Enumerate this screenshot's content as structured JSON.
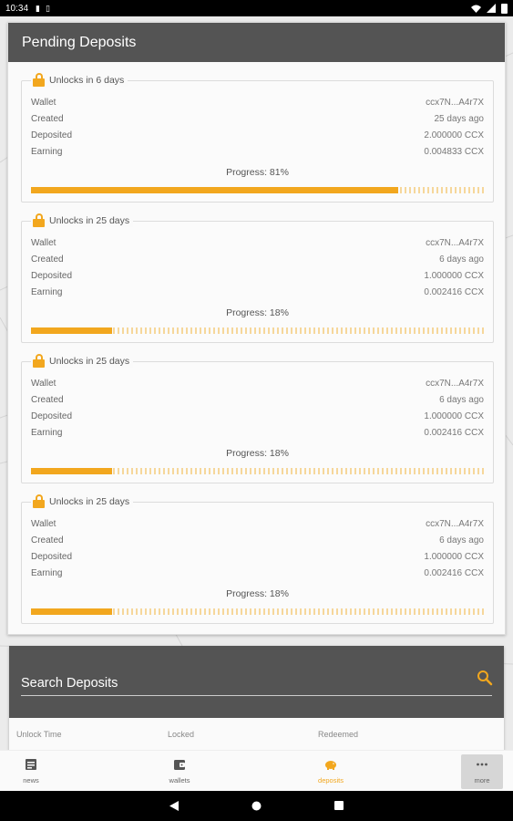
{
  "status_bar": {
    "time": "10:34"
  },
  "pending": {
    "title": "Pending Deposits",
    "deposits": [
      {
        "unlock": "Unlocks in 6 days",
        "wallet": "ccx7N...A4r7X",
        "created": "25 days ago",
        "deposited": "2.000000 CCX",
        "earning": "0.004833 CCX",
        "progress_text": "Progress:  81%",
        "progress": 0.81
      },
      {
        "unlock": "Unlocks in 25 days",
        "wallet": "ccx7N...A4r7X",
        "created": "6 days ago",
        "deposited": "1.000000 CCX",
        "earning": "0.002416 CCX",
        "progress_text": "Progress:  18%",
        "progress": 0.18
      },
      {
        "unlock": "Unlocks in 25 days",
        "wallet": "ccx7N...A4r7X",
        "created": "6 days ago",
        "deposited": "1.000000 CCX",
        "earning": "0.002416 CCX",
        "progress_text": "Progress:  18%",
        "progress": 0.18
      },
      {
        "unlock": "Unlocks in 25 days",
        "wallet": "ccx7N...A4r7X",
        "created": "6 days ago",
        "deposited": "1.000000 CCX",
        "earning": "0.002416 CCX",
        "progress_text": "Progress:  18%",
        "progress": 0.18
      }
    ],
    "labels": {
      "wallet": "Wallet",
      "created": "Created",
      "deposited": "Deposited",
      "earning": "Earning"
    }
  },
  "search": {
    "placeholder": "Search Deposits",
    "columns": [
      "Unlock Time",
      "Locked",
      "Redeemed"
    ]
  },
  "bottom_nav": {
    "items": [
      {
        "label": "news",
        "icon": "news-icon"
      },
      {
        "label": "wallets",
        "icon": "wallet-icon"
      },
      {
        "label": "deposits",
        "icon": "piggy-bank-icon",
        "active": true
      },
      {
        "label": "more",
        "icon": "more-dots-icon"
      }
    ]
  },
  "colors": {
    "accent": "#f2a71e",
    "header": "#545454",
    "background": "#ebebeb"
  }
}
